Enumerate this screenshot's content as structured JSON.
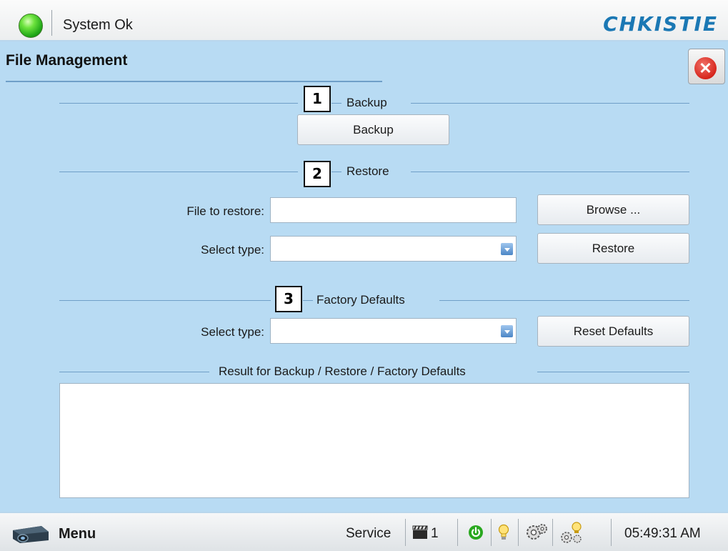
{
  "header": {
    "status_text": "System Ok",
    "logo_text": "CHKISTIE",
    "status_color": "#2bbf1f",
    "brand_color": "#1b78b4"
  },
  "page": {
    "title": "File Management",
    "close_icon": "close-icon"
  },
  "backup": {
    "callout": "1",
    "section_label": "Backup",
    "button_label": "Backup"
  },
  "restore": {
    "callout": "2",
    "section_label": "Restore",
    "file_label": "File to restore:",
    "file_value": "",
    "browse_label": "Browse ...",
    "type_label": "Select type:",
    "type_value": "",
    "restore_label": "Restore"
  },
  "factory": {
    "callout": "3",
    "section_label": "Factory Defaults",
    "type_label": "Select type:",
    "type_value": "",
    "reset_label": "Reset Defaults"
  },
  "result": {
    "section_label": "Result for Backup / Restore / Factory Defaults",
    "text": ""
  },
  "footer": {
    "menu_label": "Menu",
    "service_label": "Service",
    "channel": "1",
    "time": "05:49:31 AM",
    "icons": [
      "projector-icon",
      "clapper-icon",
      "power-icon",
      "bulb-icon",
      "gear-icon",
      "lamp-gear-icon"
    ]
  }
}
